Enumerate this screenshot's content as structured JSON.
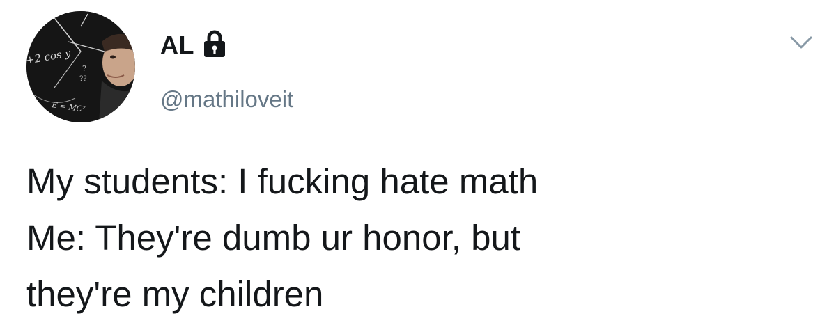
{
  "tweet": {
    "author": {
      "display_name": "AL",
      "handle": "@mathiloveit",
      "protected_icon": "lock-icon",
      "avatar": {
        "icon": "avatar-image",
        "overlay_text": [
          "+2 cos y",
          "E = MC²",
          "?",
          "??"
        ]
      }
    },
    "menu_icon": "chevron-down-icon",
    "text_lines": [
      "My students: I fucking hate math",
      "Me: They're dumb ur honor, but",
      "they're my children"
    ]
  },
  "colors": {
    "name": "#14171a",
    "handle": "#657786",
    "chevron": "#8899a6",
    "background": "#ffffff"
  }
}
